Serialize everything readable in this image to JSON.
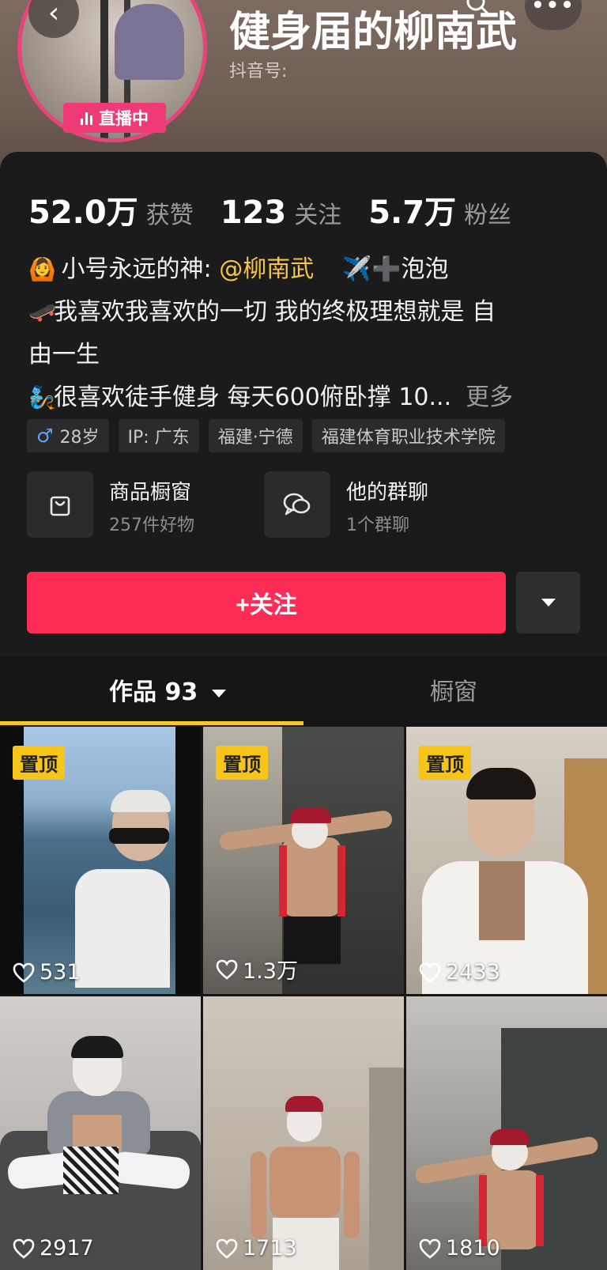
{
  "header": {
    "nickname": "健身届的柳南武",
    "douyin_id_label": "抖音号:",
    "live_badge": "直播中",
    "back_icon": "‹",
    "more_icon": "•••"
  },
  "stats": [
    {
      "value": "52.0万",
      "label": "获赞"
    },
    {
      "value": "123",
      "label": "关注"
    },
    {
      "value": "5.7万",
      "label": "粉丝"
    }
  ],
  "bio": {
    "line1_emoji": "🙆",
    "line1_prefix": "小号永远的神:",
    "line1_mention": "@柳南武",
    "line1_emoji2": "✈️➕",
    "line1_suffix": "泡泡",
    "line2_emoji": "🛹",
    "line2_text": "我喜欢我喜欢的一切 我的终极理想就是 自",
    "line3_text": "由一生",
    "line4_emoji": "🧞",
    "line4_text": "很喜欢徒手健身 每天600俯卧撑 10...",
    "more_link": "更多"
  },
  "tags": {
    "gender_symbol": "♂",
    "age": "28岁",
    "ip": "IP: 广东",
    "location": "福建·宁德",
    "school": "福建体育职业技术学院"
  },
  "entries": {
    "shop_title": "商品橱窗",
    "shop_sub": "257件好物",
    "group_title": "他的群聊",
    "group_sub": "1个群聊"
  },
  "actions": {
    "follow_label": "+关注"
  },
  "tabs": {
    "works_label": "作品 93",
    "shop_label": "橱窗"
  },
  "videos": [
    {
      "pinned": "置顶",
      "likes": "531"
    },
    {
      "pinned": "置顶",
      "likes": "1.3万"
    },
    {
      "pinned": "置顶",
      "likes": "2433"
    },
    {
      "pinned": "",
      "likes": "2917"
    },
    {
      "pinned": "",
      "likes": "1713"
    },
    {
      "pinned": "",
      "likes": "1810"
    }
  ],
  "colors": {
    "follow": "#fd2c55",
    "live": "#f03a76",
    "mention": "#f5c543",
    "pin": "#f7c419",
    "tab_indicator": "#f5c92a"
  }
}
